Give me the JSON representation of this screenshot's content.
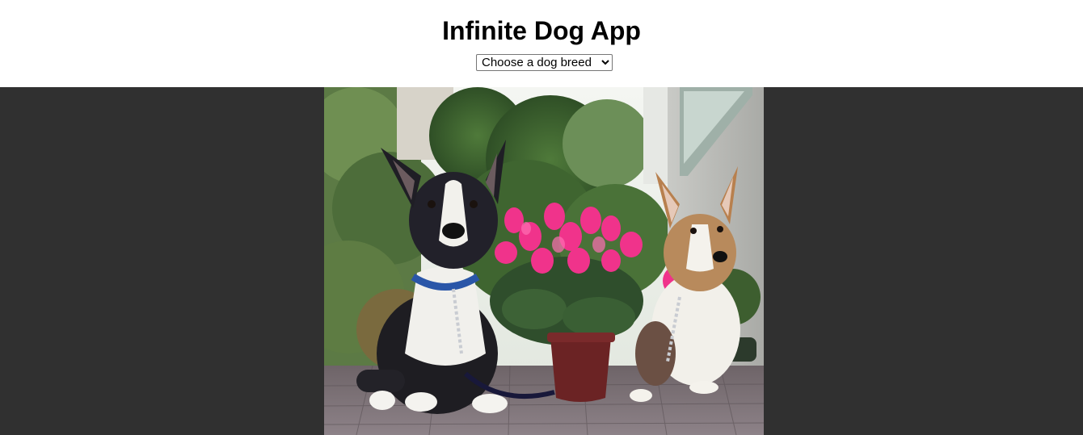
{
  "header": {
    "title": "Infinite Dog App"
  },
  "breed_select": {
    "selected_label": "Choose a dog breed",
    "options": [
      "Choose a dog breed"
    ]
  },
  "photo": {
    "alt": "Two corgis sitting beside a pot of pink cyclamen flowers on a patio"
  },
  "colors": {
    "page_background": "#ffffff",
    "stage_background": "#303030",
    "title_color": "#000000"
  }
}
